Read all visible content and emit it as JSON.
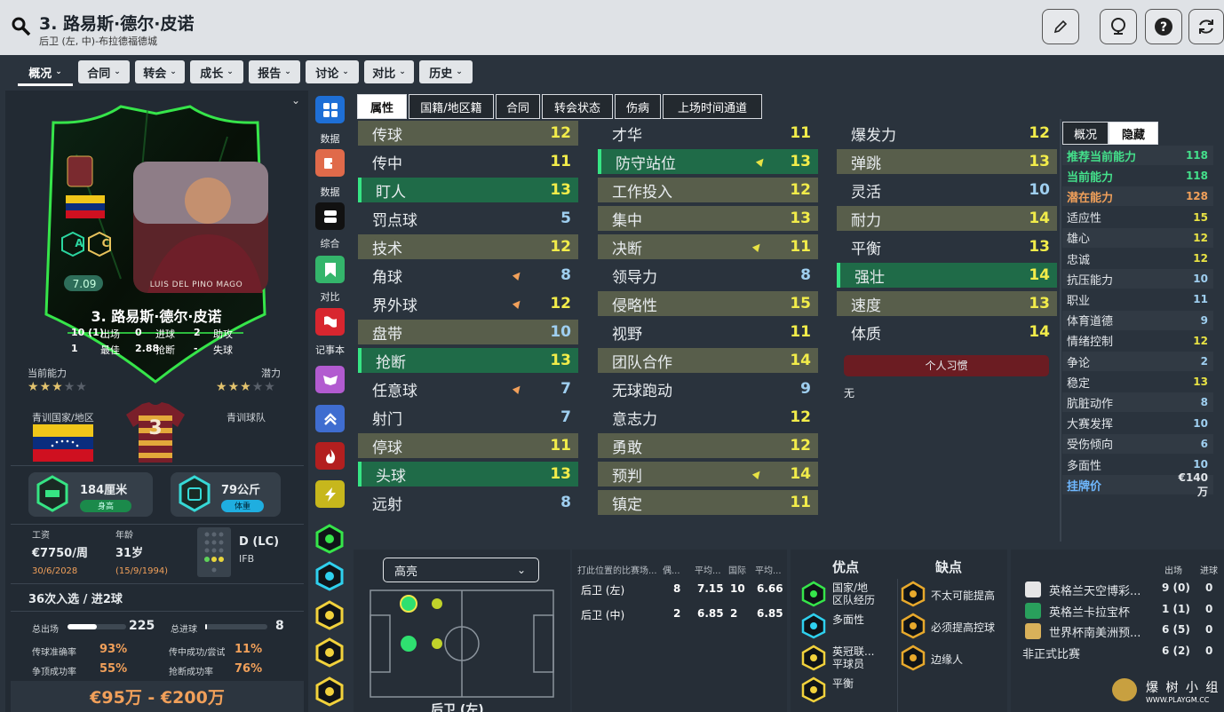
{
  "header": {
    "title": "3. 路易斯·德尔·皮诺",
    "subtitle": "后卫 (左, 中)-布拉德福德城"
  },
  "nav": [
    "概况",
    "合同",
    "转会",
    "成长",
    "报告",
    "讨论",
    "对比",
    "历史"
  ],
  "card": {
    "player_name": "3. 路易斯·德尔·皮诺",
    "rating": "7.09",
    "jersey_text": "LUIS DEL PINO MAGO",
    "stats": [
      [
        "10 (1)",
        "出场",
        "0",
        "进球",
        "2",
        "助攻"
      ],
      [
        "1",
        "最佳",
        "2.88",
        "抢断",
        "-",
        "失球"
      ]
    ],
    "badges": [
      "A",
      "C"
    ]
  },
  "ability": {
    "current_label": "当前能力",
    "potential_label": "潜力",
    "current_stars": 3,
    "potential_stars": 3
  },
  "youth": {
    "nation_label": "青训国家/地区",
    "club_label": "青训球队",
    "shirt_number": "3"
  },
  "physical": {
    "height": "184厘米",
    "height_tag": "身高",
    "weight": "79公斤",
    "weight_tag": "体重"
  },
  "info": {
    "wage_label": "工资",
    "wage": "€7750/周",
    "age_label": "年龄",
    "age": "31岁",
    "contract": "30/6/2028",
    "dob": "(15/9/1994)",
    "position": "D (LC)",
    "position_sub": "IFB"
  },
  "caps": "36次入选 / 进2球",
  "totals": {
    "apps_label": "总出场",
    "apps": "225",
    "goals_label": "总进球",
    "goals": "8"
  },
  "rates": [
    [
      "传球准确率",
      "93%",
      "传中成功/尝试",
      "11%"
    ],
    [
      "争顶成功率",
      "55%",
      "抢断成功率",
      "76%"
    ]
  ],
  "value": "€95万 - €200万",
  "side": [
    "数据",
    "数据",
    "综合",
    "对比",
    "记事本"
  ],
  "attr_tabs": [
    "属性",
    "国籍/地区籍",
    "合同",
    "转会状态",
    "伤病",
    "上场时间通道"
  ],
  "col1": [
    [
      "传球",
      "12",
      1,
      ""
    ],
    [
      "传中",
      "11",
      0,
      ""
    ],
    [
      "盯人",
      "13",
      2,
      ""
    ],
    [
      "罚点球",
      "5",
      0,
      ""
    ],
    [
      "技术",
      "12",
      1,
      ""
    ],
    [
      "角球",
      "8",
      0,
      "o"
    ],
    [
      "界外球",
      "12",
      0,
      "o"
    ],
    [
      "盘带",
      "10",
      1,
      ""
    ],
    [
      "抢断",
      "13",
      2,
      ""
    ],
    [
      "任意球",
      "7",
      0,
      "o"
    ],
    [
      "射门",
      "7",
      0,
      ""
    ],
    [
      "停球",
      "11",
      1,
      ""
    ],
    [
      "头球",
      "13",
      2,
      ""
    ],
    [
      "远射",
      "8",
      0,
      ""
    ]
  ],
  "col2": [
    [
      "才华",
      "11",
      0,
      ""
    ],
    [
      "防守站位",
      "13",
      2,
      "y"
    ],
    [
      "工作投入",
      "12",
      1,
      ""
    ],
    [
      "集中",
      "13",
      1,
      ""
    ],
    [
      "决断",
      "11",
      1,
      "y"
    ],
    [
      "领导力",
      "8",
      0,
      ""
    ],
    [
      "侵略性",
      "15",
      1,
      ""
    ],
    [
      "视野",
      "11",
      0,
      ""
    ],
    [
      "团队合作",
      "14",
      1,
      ""
    ],
    [
      "无球跑动",
      "9",
      0,
      ""
    ],
    [
      "意志力",
      "12",
      0,
      ""
    ],
    [
      "勇敢",
      "12",
      1,
      ""
    ],
    [
      "预判",
      "14",
      1,
      "y"
    ],
    [
      "镇定",
      "11",
      1,
      ""
    ]
  ],
  "col3": [
    [
      "爆发力",
      "12",
      0,
      ""
    ],
    [
      "弹跳",
      "13",
      1,
      ""
    ],
    [
      "灵活",
      "10",
      0,
      ""
    ],
    [
      "耐力",
      "14",
      1,
      ""
    ],
    [
      "平衡",
      "13",
      0,
      ""
    ],
    [
      "强壮",
      "14",
      2,
      ""
    ],
    [
      "速度",
      "13",
      1,
      ""
    ],
    [
      "体质",
      "14",
      0,
      ""
    ]
  ],
  "habits": {
    "title": "个人习惯",
    "value": "无"
  },
  "hidden_tabs": [
    "概况",
    "隐藏"
  ],
  "hidden": [
    [
      "推荐当前能力",
      "118",
      "g"
    ],
    [
      "当前能力",
      "118",
      "g"
    ],
    [
      "潜在能力",
      "128",
      "o"
    ],
    [
      "适应性",
      "15",
      "w"
    ],
    [
      "雄心",
      "12",
      "w"
    ],
    [
      "忠诚",
      "12",
      "w"
    ],
    [
      "抗压能力",
      "10",
      "w"
    ],
    [
      "职业",
      "11",
      "w"
    ],
    [
      "体育道德",
      "9",
      "w"
    ],
    [
      "情绪控制",
      "12",
      "w"
    ],
    [
      "争论",
      "2",
      "w"
    ],
    [
      "稳定",
      "13",
      "w"
    ],
    [
      "肮脏动作",
      "8",
      "w"
    ],
    [
      "大赛发挥",
      "10",
      "w"
    ],
    [
      "受伤倾向",
      "6",
      "w"
    ],
    [
      "多面性",
      "10",
      "w"
    ],
    [
      "挂牌价",
      "€140万",
      "b"
    ]
  ],
  "positions": {
    "dropdown": "高亮",
    "bottom_label": "后卫 (左)",
    "table_header": [
      "打此位置的比赛场...",
      "偶...",
      "平均...",
      "国际",
      "平均..."
    ],
    "rows": [
      [
        "后卫 (左)",
        "8",
        "7.15",
        "10",
        "6.66"
      ],
      [
        "后卫 (中)",
        "2",
        "6.85",
        "2",
        "6.85"
      ]
    ]
  },
  "traits": {
    "pros_title": "优点",
    "cons_title": "缺点",
    "pros": [
      "国家/地\n区队经历",
      "多面性",
      "英冠联...\n平球员",
      "平衡"
    ],
    "cons": [
      "不太可能提高",
      "必须提高控球",
      "边缘人"
    ]
  },
  "comps": {
    "header": [
      "出场",
      "进球"
    ],
    "rows": [
      [
        "英格兰天空博彩...",
        "9 (0)",
        "0"
      ],
      [
        "英格兰卡拉宝杯",
        "1 (1)",
        "0"
      ],
      [
        "世界杯南美洲预...",
        "6 (5)",
        "0"
      ],
      [
        "非正式比赛",
        "6 (2)",
        "0"
      ]
    ]
  },
  "watermark": {
    "brand": "爆 树 小 组",
    "url": "WWW.PLAYGM.CC"
  },
  "colors": {
    "accent": "#1f6b48",
    "olive": "#585e4b",
    "yellow_val": "#f2ec4a",
    "green_val": "#44e08b",
    "neon": "#36e54a"
  }
}
